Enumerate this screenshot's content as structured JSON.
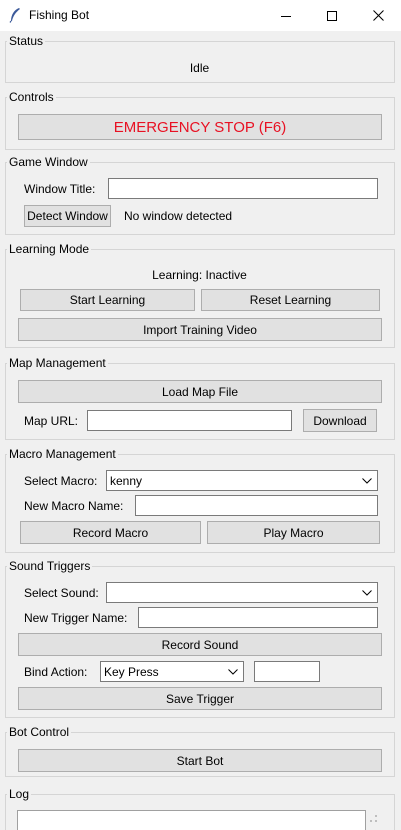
{
  "window": {
    "title": "Fishing Bot"
  },
  "status": {
    "label": "Status",
    "value": "Idle"
  },
  "controls": {
    "label": "Controls",
    "emergency_stop": "EMERGENCY STOP (F6)"
  },
  "game_window": {
    "label": "Game Window",
    "title_label": "Window Title:",
    "title_value": "",
    "detect_button": "Detect Window",
    "detect_status": "No window detected"
  },
  "learning": {
    "label": "Learning Mode",
    "status": "Learning: Inactive",
    "start_button": "Start Learning",
    "reset_button": "Reset Learning",
    "import_button": "Import Training Video"
  },
  "map": {
    "label": "Map Management",
    "load_button": "Load Map File",
    "url_label": "Map URL:",
    "url_value": "",
    "download_button": "Download"
  },
  "macro": {
    "label": "Macro Management",
    "select_label": "Select Macro:",
    "selected": "kenny",
    "new_label": "New Macro Name:",
    "new_value": "",
    "record_button": "Record Macro",
    "play_button": "Play Macro"
  },
  "sound": {
    "label": "Sound Triggers",
    "select_label": "Select Sound:",
    "selected": "",
    "new_label": "New Trigger Name:",
    "new_value": "",
    "record_button": "Record Sound",
    "bind_label": "Bind Action:",
    "bind_selected": "Key Press",
    "bind_key": "",
    "save_button": "Save Trigger"
  },
  "bot": {
    "label": "Bot Control",
    "start_button": "Start Bot"
  },
  "log": {
    "label": "Log"
  },
  "colors": {
    "emergency": "#e81123",
    "face": "#e1e1e1",
    "border": "#adadad"
  }
}
